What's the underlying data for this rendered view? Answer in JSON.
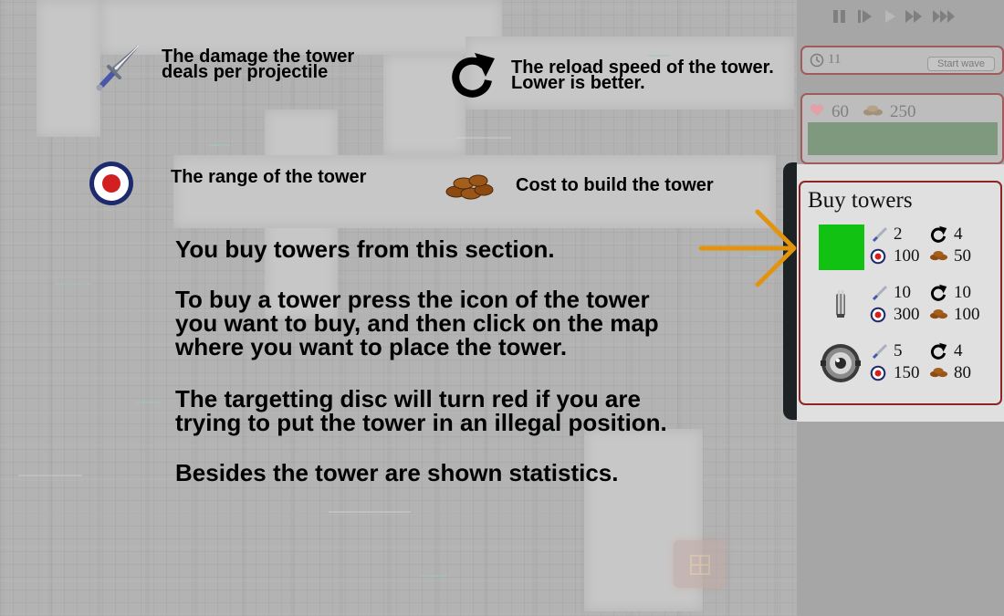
{
  "tutorial": {
    "damage_text": "The damage the tower\ndeals per projectile",
    "reload_text": "The reload speed of the tower.\nLower is better.",
    "range_text": "The range of the tower",
    "cost_text": "Cost to build the tower",
    "paragraphs": [
      "You buy towers from this section.",
      "To buy a tower press the icon of the tower\nyou want to buy, and then click on the map\nwhere you want to place the tower.",
      "The targetting disc will turn red if you are\ntrying to put the tower in an illegal position.",
      "Besides the tower are shown statistics."
    ]
  },
  "speed_controls": [
    "pause-icon",
    "step-icon",
    "play-icon",
    "fast-forward-icon",
    "fastest-forward-icon"
  ],
  "wave": {
    "number": "11",
    "start_label": "Start wave"
  },
  "status": {
    "lives": "60",
    "money": "250"
  },
  "buy_panel": {
    "title": "Buy towers",
    "towers": [
      {
        "icon": "green-square-tower-icon",
        "damage": "2",
        "reload": "4",
        "range": "100",
        "cost": "50"
      },
      {
        "icon": "cannon-tower-icon",
        "damage": "10",
        "reload": "10",
        "range": "300",
        "cost": "100"
      },
      {
        "icon": "orb-turret-tower-icon",
        "damage": "5",
        "reload": "4",
        "range": "150",
        "cost": "80"
      }
    ]
  },
  "colors": {
    "accent_arrow": "#e3940f",
    "panel_border": "#8e2424",
    "health_bar": "#7f997f",
    "tower_green": "#12c212",
    "target_red": "#d22020",
    "target_blue": "#1d2a6e"
  }
}
